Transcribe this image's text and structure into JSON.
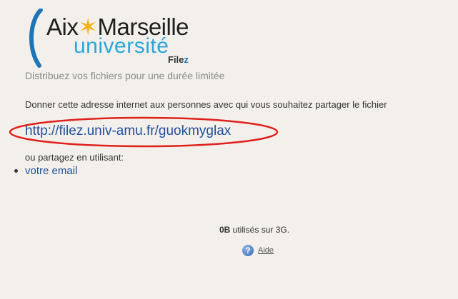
{
  "logo": {
    "aix": "Aix",
    "star": "✶",
    "marseille": "Marseille",
    "universite": "université",
    "filez_prefix": "File",
    "filez_suffix": "z"
  },
  "tagline": "Distribuez vos fichiers pour une durée limitée",
  "instruction": "Donner cette adresse internet aux personnes avec qui vous souhaitez partager le fichier",
  "share_link": "http://filez.univ-amu.fr/guokmyglax",
  "share_alt_label": "ou partagez en utilisant:",
  "share_options": [
    {
      "label": "votre email"
    }
  ],
  "usage": {
    "amount": "0B",
    "text": " utilisés sur 3G."
  },
  "help": {
    "icon": "help-icon",
    "label": "Aide"
  },
  "colors": {
    "background": "#f3f0eb",
    "link": "#1f4f9f",
    "highlight_ellipse": "#e0201b",
    "logo_blue": "#2aa6dc",
    "logo_star": "#f3b41b"
  }
}
